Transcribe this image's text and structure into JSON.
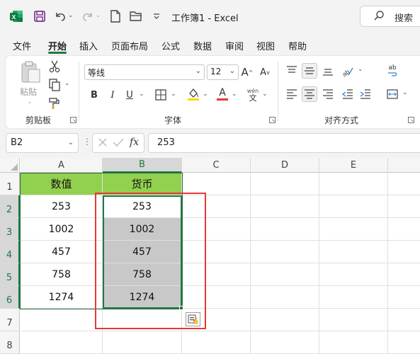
{
  "titlebar": {
    "title": "工作簿1 - Excel",
    "search_placeholder": "搜索",
    "icons": [
      "excel-logo-icon",
      "save-icon",
      "undo-icon",
      "redo-icon",
      "new-file-icon",
      "open-folder-icon",
      "customize-toolbar-icon",
      "search-icon"
    ]
  },
  "tabs": [
    {
      "label": "文件"
    },
    {
      "label": "开始",
      "active": true
    },
    {
      "label": "插入"
    },
    {
      "label": "页面布局"
    },
    {
      "label": "公式"
    },
    {
      "label": "数据"
    },
    {
      "label": "审阅"
    },
    {
      "label": "视图"
    },
    {
      "label": "帮助"
    }
  ],
  "ribbon": {
    "clipboard": {
      "group_label": "剪贴板",
      "paste_label": "粘贴"
    },
    "font": {
      "group_label": "字体",
      "font_name": "等线",
      "font_size": "12",
      "bold": "B",
      "italic": "I",
      "underline": "U",
      "font_color_letter": "A",
      "phonetic_top": "wén",
      "phonetic_char": "文",
      "grow_font": "A",
      "shrink_font": "A",
      "font_color": "#e53935",
      "fill_color": "#ffd600"
    },
    "alignment": {
      "group_label": "对齐方式",
      "wrap_label": "ab"
    }
  },
  "formula_bar": {
    "name_box": "B2",
    "fx_label": "fx",
    "formula": "253"
  },
  "sheet": {
    "columns": [
      "A",
      "B",
      "C",
      "D",
      "E"
    ],
    "rows": [
      "1",
      "2",
      "3",
      "4",
      "5",
      "6",
      "7",
      "8"
    ],
    "selected_column": "B",
    "selected_range": "B2:B6",
    "header_row": [
      "数值",
      "货币"
    ],
    "data": [
      [
        "253",
        "253"
      ],
      [
        "1002",
        "1002"
      ],
      [
        "457",
        "457"
      ],
      [
        "758",
        "758"
      ],
      [
        "1274",
        "1274"
      ]
    ],
    "header_fill": "#92d050",
    "selection_fill": "#c8c8c8",
    "highlight_box_color": "#e53935",
    "accent": "#1e7a44"
  }
}
